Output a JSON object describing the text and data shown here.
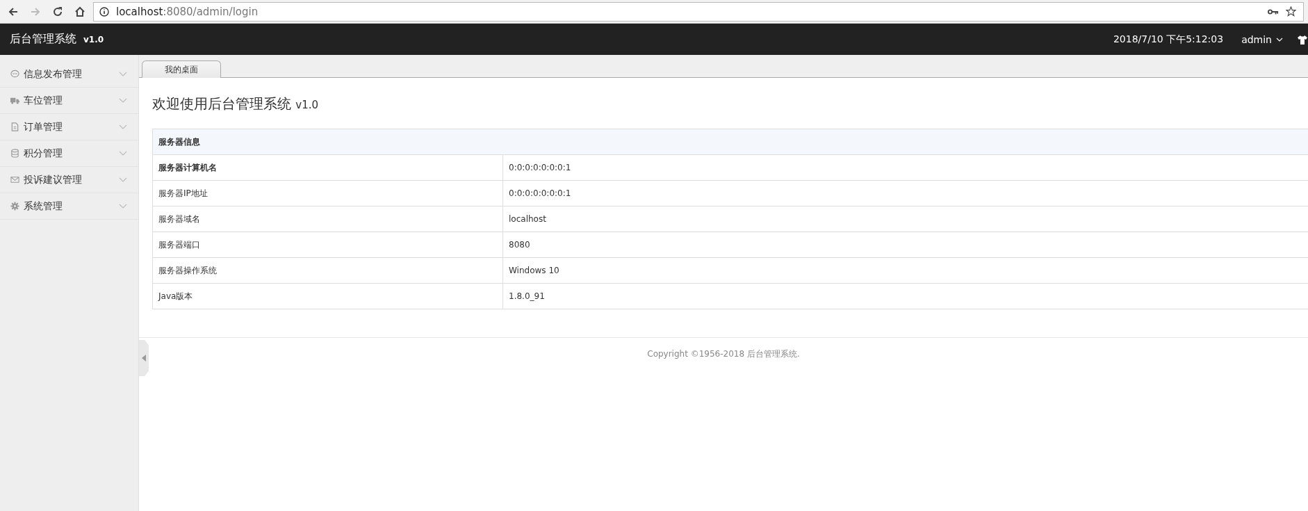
{
  "browser": {
    "nav_buttons": [
      {
        "kind": "back",
        "disabled": false
      },
      {
        "kind": "forward",
        "disabled": true
      },
      {
        "kind": "reload",
        "disabled": false
      },
      {
        "kind": "home",
        "disabled": false
      }
    ],
    "url_host": "localhost",
    "url_rest": ":8080/admin/login"
  },
  "header": {
    "title": "后台管理系统",
    "version": "v1.0",
    "datetime": "2018/7/10 下午5:12:03",
    "user": "admin"
  },
  "sidebar": {
    "items": [
      {
        "label": "信息发布管理",
        "kind": "chat"
      },
      {
        "label": "车位管理",
        "kind": "truck"
      },
      {
        "label": "订单管理",
        "kind": "document"
      },
      {
        "label": "积分管理",
        "kind": "database"
      },
      {
        "label": "投诉建议管理",
        "kind": "envelope"
      },
      {
        "label": "系统管理",
        "kind": "gear"
      }
    ]
  },
  "tabs": [
    {
      "label": "我的桌面",
      "selected": true
    }
  ],
  "welcome": {
    "title": "欢迎使用后台管理系统",
    "version": "v1.0"
  },
  "table": {
    "heading": "服务器信息",
    "rows": [
      {
        "label": "服务器计算机名",
        "value": "0:0:0:0:0:0:0:1",
        "bold": true
      },
      {
        "label": "服务器IP地址",
        "value": "0:0:0:0:0:0:0:1",
        "bold": false
      },
      {
        "label": "服务器域名",
        "value": "localhost",
        "bold": false
      },
      {
        "label": "服务器端口",
        "value": "8080",
        "bold": false
      },
      {
        "label": "服务器操作系统",
        "value": "Windows 10",
        "bold": false
      },
      {
        "label": "Java版本",
        "value": "1.8.0_91",
        "bold": false
      }
    ]
  },
  "footer": {
    "copyright": "Copyright ©1956-2018 后台管理系统."
  }
}
